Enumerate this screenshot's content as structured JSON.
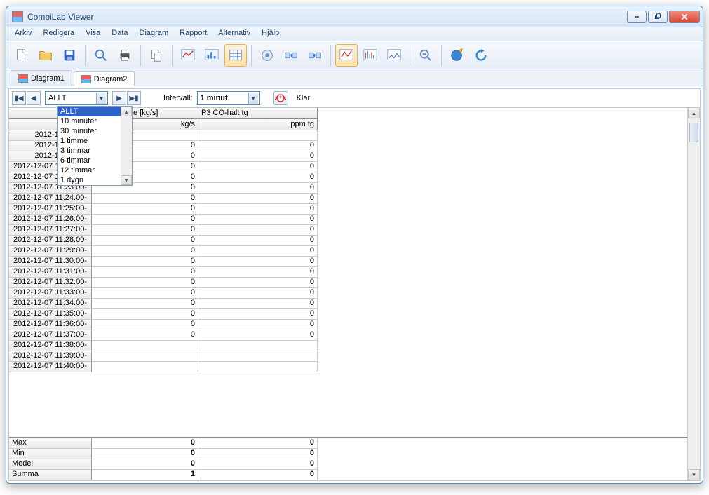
{
  "window": {
    "title": "CombiLab Viewer"
  },
  "menu": [
    "Arkiv",
    "Redigera",
    "Visa",
    "Data",
    "Diagram",
    "Rapport",
    "Alternativ",
    "Hjälp"
  ],
  "tabs": [
    {
      "label": "Diagram1",
      "active": false
    },
    {
      "label": "Diagram2",
      "active": true
    }
  ],
  "controlbar": {
    "range_selected": "ALLT",
    "range_options": [
      "ALLT",
      "10 minuter",
      "30 minuter",
      "1 timme",
      "3 timmar",
      "6 timmar",
      "12 timmar",
      "1 dygn"
    ],
    "interval_label": "Intervall:",
    "interval_selected": "1 minut",
    "status": "Klar"
  },
  "grid": {
    "columns": [
      {
        "headertop": "",
        "headerbot": ""
      },
      {
        "headertop": "Bränsleflöde [kg/s]",
        "headerbot": "kg/s"
      },
      {
        "headertop": "P3 CO-halt tg",
        "headerbot": "ppm tg"
      }
    ],
    "rows": [
      {
        "t": "2012-12-",
        "v1": "",
        "v2": ""
      },
      {
        "t": "2012-12-",
        "v1": "0",
        "v2": "0"
      },
      {
        "t": "2012-12-",
        "v1": "0",
        "v2": "0"
      },
      {
        "t": "2012-12-07 11:21:00-",
        "v1": "0",
        "v2": "0"
      },
      {
        "t": "2012-12-07 11:22:00-",
        "v1": "0",
        "v2": "0"
      },
      {
        "t": "2012-12-07 11:23:00-",
        "v1": "0",
        "v2": "0"
      },
      {
        "t": "2012-12-07 11:24:00-",
        "v1": "0",
        "v2": "0"
      },
      {
        "t": "2012-12-07 11:25:00-",
        "v1": "0",
        "v2": "0"
      },
      {
        "t": "2012-12-07 11:26:00-",
        "v1": "0",
        "v2": "0"
      },
      {
        "t": "2012-12-07 11:27:00-",
        "v1": "0",
        "v2": "0"
      },
      {
        "t": "2012-12-07 11:28:00-",
        "v1": "0",
        "v2": "0"
      },
      {
        "t": "2012-12-07 11:29:00-",
        "v1": "0",
        "v2": "0"
      },
      {
        "t": "2012-12-07 11:30:00-",
        "v1": "0",
        "v2": "0"
      },
      {
        "t": "2012-12-07 11:31:00-",
        "v1": "0",
        "v2": "0"
      },
      {
        "t": "2012-12-07 11:32:00-",
        "v1": "0",
        "v2": "0"
      },
      {
        "t": "2012-12-07 11:33:00-",
        "v1": "0",
        "v2": "0"
      },
      {
        "t": "2012-12-07 11:34:00-",
        "v1": "0",
        "v2": "0"
      },
      {
        "t": "2012-12-07 11:35:00-",
        "v1": "0",
        "v2": "0"
      },
      {
        "t": "2012-12-07 11:36:00-",
        "v1": "0",
        "v2": "0"
      },
      {
        "t": "2012-12-07 11:37:00-",
        "v1": "0",
        "v2": "0"
      },
      {
        "t": "2012-12-07 11:38:00-",
        "v1": "",
        "v2": ""
      },
      {
        "t": "2012-12-07 11:39:00-",
        "v1": "",
        "v2": ""
      },
      {
        "t": "2012-12-07 11:40:00-",
        "v1": "",
        "v2": ""
      }
    ],
    "summary": [
      {
        "label": "Max",
        "v1": "0",
        "v2": "0"
      },
      {
        "label": "Min",
        "v1": "0",
        "v2": "0"
      },
      {
        "label": "Medel",
        "v1": "0",
        "v2": "0"
      },
      {
        "label": "Summa",
        "v1": "1",
        "v2": "0"
      }
    ]
  }
}
